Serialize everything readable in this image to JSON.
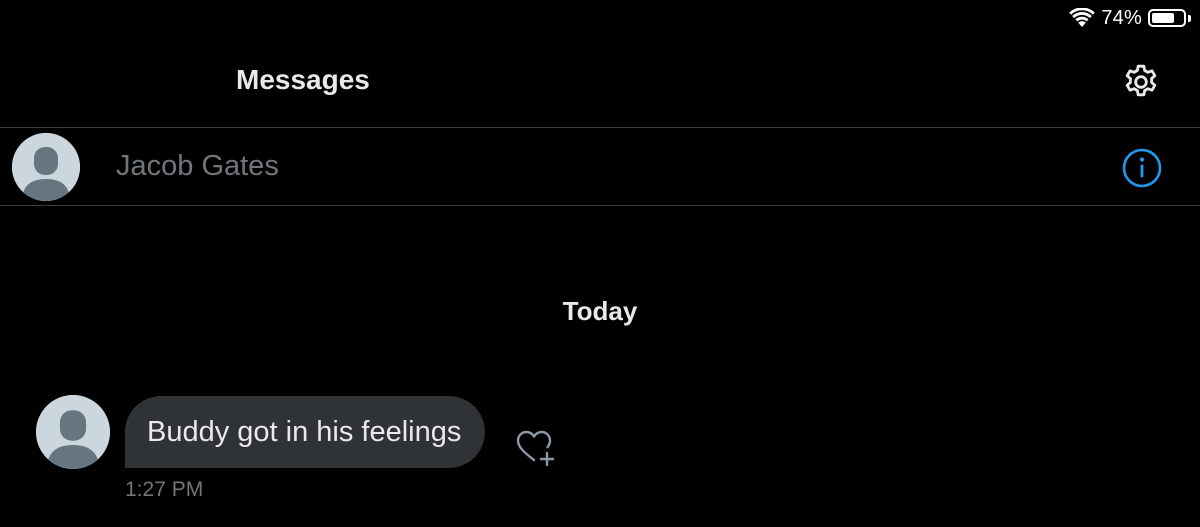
{
  "status_bar": {
    "battery_percent": "74%",
    "battery_level": 0.74,
    "icons": [
      "wifi-icon",
      "battery-icon"
    ]
  },
  "header": {
    "title": "Messages",
    "settings_icon": "gear-icon"
  },
  "conversation": {
    "contact_name": "Jacob Gates",
    "avatar_icon": "default-avatar-icon",
    "info_icon": "info-icon"
  },
  "thread": {
    "day_label": "Today",
    "messages": [
      {
        "text": "Buddy got in his feelings",
        "time": "1:27 PM",
        "react_icon": "heart-plus-icon"
      }
    ]
  },
  "colors": {
    "background": "#000000",
    "bubble": "#2f3336",
    "accent": "#1d9bf0",
    "muted_text": "#71767b",
    "divider": "#3a3d40"
  }
}
